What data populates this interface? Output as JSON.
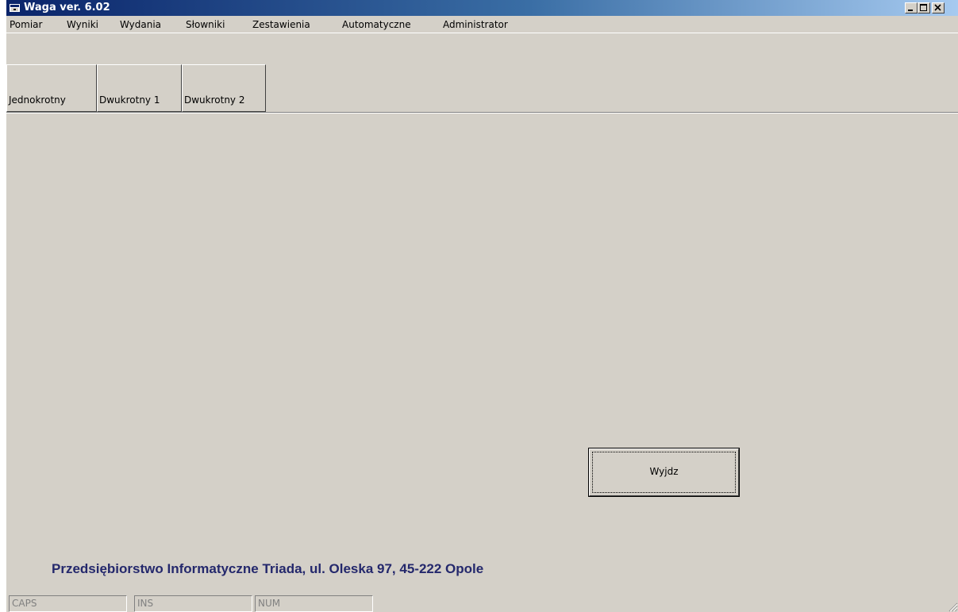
{
  "window": {
    "title": "Waga ver. 6.02",
    "controls": {
      "minimize": "minimize-icon",
      "maximize": "maximize-icon",
      "close": "close-icon"
    }
  },
  "menu": {
    "items": [
      {
        "label": "Pomiar"
      },
      {
        "label": "Wyniki"
      },
      {
        "label": "Wydania"
      },
      {
        "label": "Słowniki"
      },
      {
        "label": "Zestawienia"
      },
      {
        "label": "Automatyczne"
      },
      {
        "label": "Administrator"
      }
    ]
  },
  "toolbar": {
    "buttons": [
      {
        "label": "Jednokrotny"
      },
      {
        "label": "Dwukrotny 1"
      },
      {
        "label": "Dwukrotny 2"
      }
    ]
  },
  "main": {
    "exit_label": "Wyjdz"
  },
  "footer": {
    "company": "Przedsiębiorstwo Informatyczne Triada, ul. Oleska 97, 45-222 Opole"
  },
  "status": {
    "panes": [
      "CAPS",
      "INS",
      "NUM"
    ]
  },
  "colors": {
    "face": "#d4d0c8",
    "title_start": "#0a246a",
    "title_end": "#a6caf0",
    "footer_text": "#24286c",
    "status_text": "#808080"
  }
}
